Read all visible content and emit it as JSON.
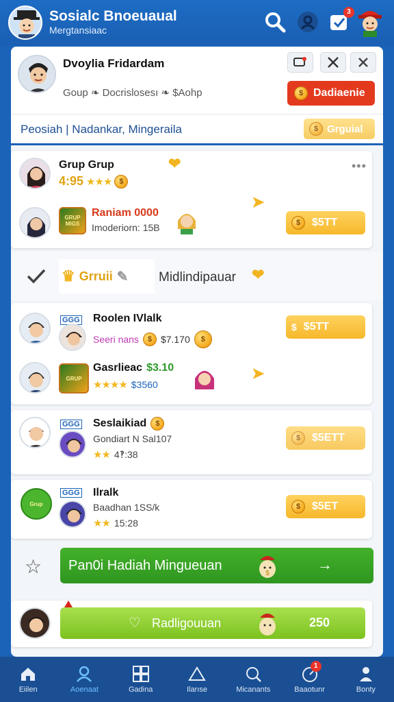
{
  "header": {
    "title": "Sosialc Bnoeuaual",
    "subtitle": "Mergtansiaac",
    "notification_count": "3"
  },
  "profile": {
    "name": "Dvoylia Fridardam",
    "meta": "Goup  ❧ Docrislosesı  ❧ $Aohp",
    "cta_label": "Dadiaenie"
  },
  "section": {
    "title": "Peosiah | Nadankar, Mingeraila",
    "pill_label": "Grguial"
  },
  "group_filter": {
    "label": "Grruii",
    "title": "Midlindipauar"
  },
  "feed": [
    {
      "name": "Grup Grup",
      "sub": "4:95",
      "stars": "★★★"
    },
    {
      "name": "Raniam 0000",
      "sub": "Imoderiorn: 15B",
      "amount": "$5TT",
      "thumb_text": "GRUP MIGS"
    }
  ],
  "list": [
    {
      "tag": "GGG",
      "name": "Roolen IVlalk",
      "sub": "Seeri nans",
      "sub_amount": "$7.170",
      "amount": "$5TT"
    },
    {
      "name": "Gasrlieac",
      "amount_green": "$3.10",
      "stars": "★★★★",
      "sub_amount": "$3560",
      "thumb_text": "GRUP"
    },
    {
      "tag": "GGG",
      "name": "Seslaikiad",
      "sub": "Gondiart N Sal107",
      "stars": "★★",
      "sub_amount": "4‽:38",
      "amount": "$5ETT"
    },
    {
      "tag": "GGG",
      "name": "Ilralk",
      "sub": "Baadhan 1SS/k",
      "stars": "★★",
      "sub_amount": "15:28",
      "amount": "$5ET",
      "thumb_text": "Grup"
    }
  ],
  "cta": {
    "primary": "Pan0i Hadiah Mingueuan",
    "secondary": "Radligouuan",
    "secondary_value": "250"
  },
  "nav": [
    {
      "label": "Eiilen",
      "icon": "home-icon"
    },
    {
      "label": "Aoenaat",
      "icon": "user-icon",
      "active": true
    },
    {
      "label": "Gadina",
      "icon": "grid-icon"
    },
    {
      "label": "Ilarıse",
      "icon": "tent-icon"
    },
    {
      "label": "Micanants",
      "icon": "search-badge-icon"
    },
    {
      "label": "Baaotunr",
      "icon": "gauge-icon",
      "badge": "1"
    },
    {
      "label": "Bonty",
      "icon": "profile-icon"
    }
  ]
}
